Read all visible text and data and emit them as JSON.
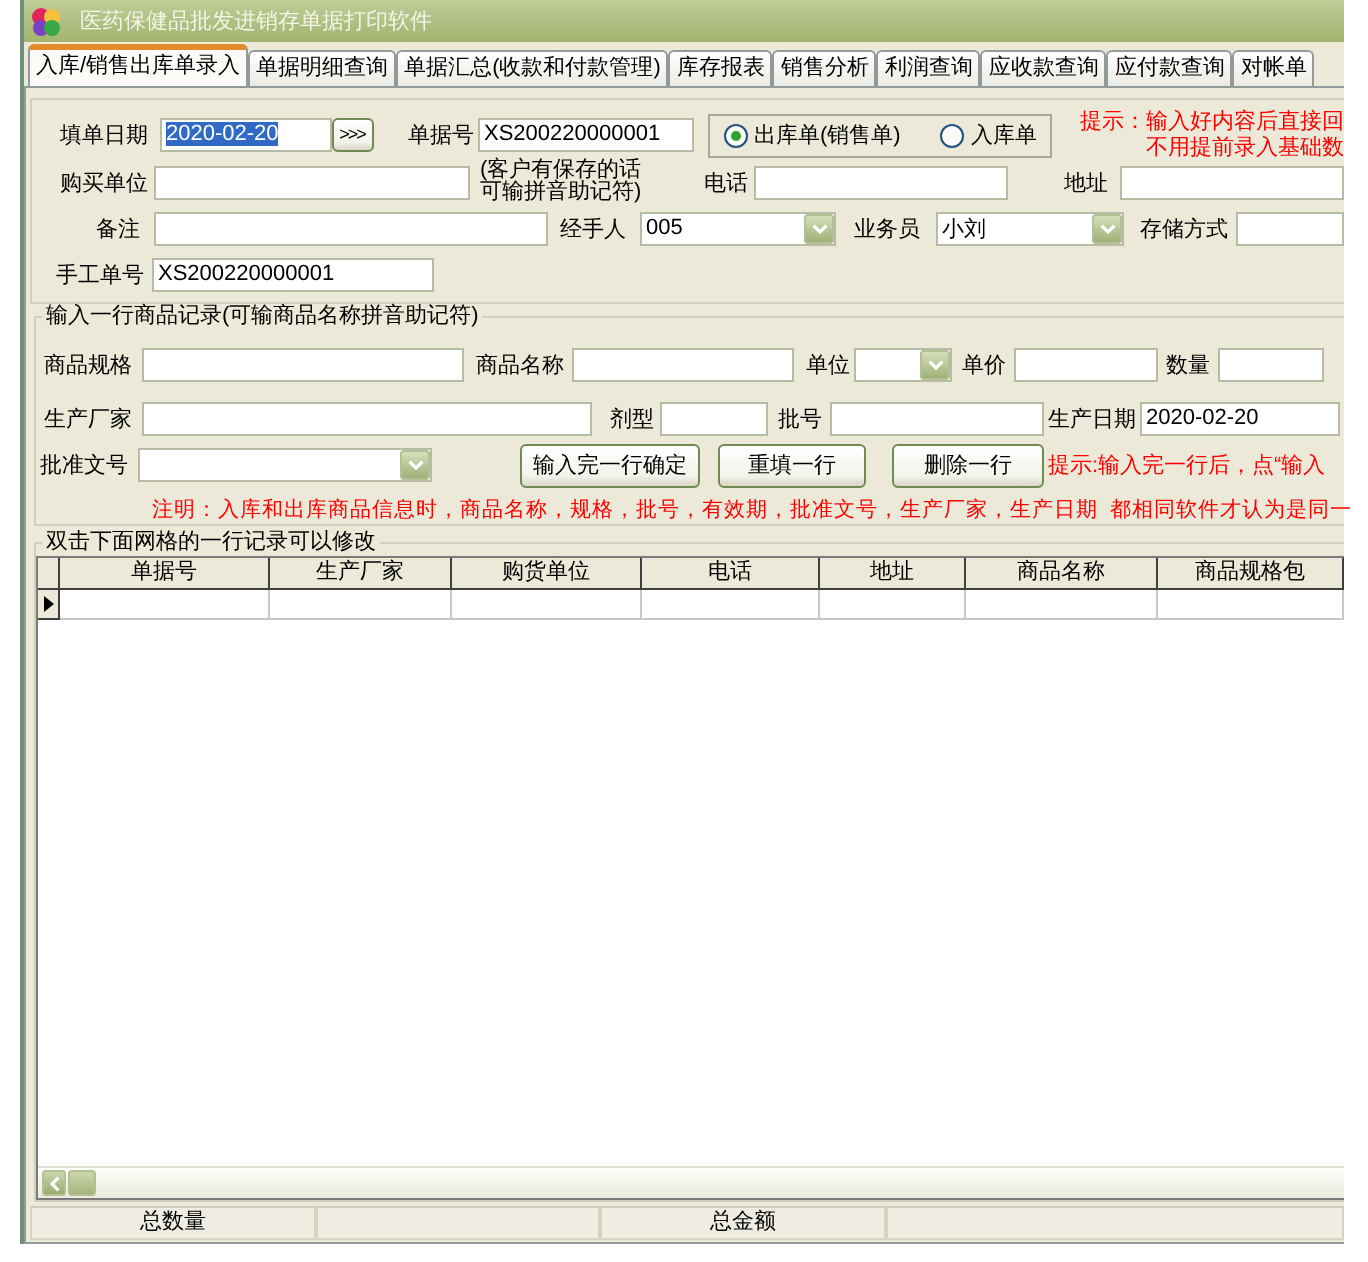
{
  "window": {
    "title": "医药保健品批发进销存单据打印软件"
  },
  "tabs": [
    {
      "label": "入库/销售出库单录入",
      "selected": true
    },
    {
      "label": "单据明细查询",
      "selected": false
    },
    {
      "label": "单据汇总(收款和付款管理)",
      "selected": false
    },
    {
      "label": "库存报表",
      "selected": false
    },
    {
      "label": "销售分析",
      "selected": false
    },
    {
      "label": "利润查询",
      "selected": false
    },
    {
      "label": "应收款查询",
      "selected": false
    },
    {
      "label": "应付款查询",
      "selected": false
    },
    {
      "label": "对帐单",
      "selected": false
    }
  ],
  "header_form": {
    "date": {
      "label": "填单日期",
      "value": "2020-02-20",
      "highlighted": true
    },
    "date_button": ">>>",
    "doc_no": {
      "label": "单据号",
      "value": "XS200220000001"
    },
    "doc_type": [
      {
        "label": "出库单(销售单)",
        "selected": true
      },
      {
        "label": "入库单",
        "selected": false
      }
    ],
    "hint_lines": [
      "提示：输入好内容后直接回",
      "不用提前录入基础数"
    ],
    "buyer": {
      "label": "购买单位"
    },
    "buyer_note_lines": [
      "(客户有保存的话",
      "可输拼音助记符)"
    ],
    "phone": {
      "label": "电话"
    },
    "address": {
      "label": "地址"
    },
    "remark": {
      "label": "备注"
    },
    "handler": {
      "label": "经手人",
      "value": "005"
    },
    "salesperson": {
      "label": "业务员",
      "value": "小刘"
    },
    "storage": {
      "label": "存储方式"
    },
    "manual_no": {
      "label": "手工单号",
      "value": "XS200220000001"
    }
  },
  "item_form": {
    "title": "输入一行商品记录(可输商品名称拼音助记符)",
    "spec": {
      "label": "商品规格"
    },
    "name": {
      "label": "商品名称"
    },
    "unit": {
      "label": "单位"
    },
    "price": {
      "label": "单价"
    },
    "qty": {
      "label": "数量"
    },
    "maker": {
      "label": "生产厂家"
    },
    "dosage_form": {
      "label": "剂型"
    },
    "batch": {
      "label": "批号"
    },
    "prod_date": {
      "label": "生产日期",
      "value": "2020-02-20"
    },
    "approval_no": {
      "label": "批准文号"
    },
    "buttons": [
      "输入完一行确定",
      "重填一行",
      "删除一行"
    ],
    "hint": "提示:输入完一行后，点“输入",
    "note": "注明：入库和出库商品信息时，商品名称，规格，批号，有效期，批准文号，生产厂家，生产日期  都相同软件才认为是同一"
  },
  "grid": {
    "title": "双击下面网格的一行记录可以修改",
    "columns": [
      "单据号",
      "生产厂家",
      "购货单位",
      "电话",
      "地址",
      "商品名称",
      "商品规格包"
    ],
    "rows": [
      {
        "selected": true
      }
    ]
  },
  "status_bar": {
    "labels": [
      "总数量",
      "总金额"
    ]
  }
}
